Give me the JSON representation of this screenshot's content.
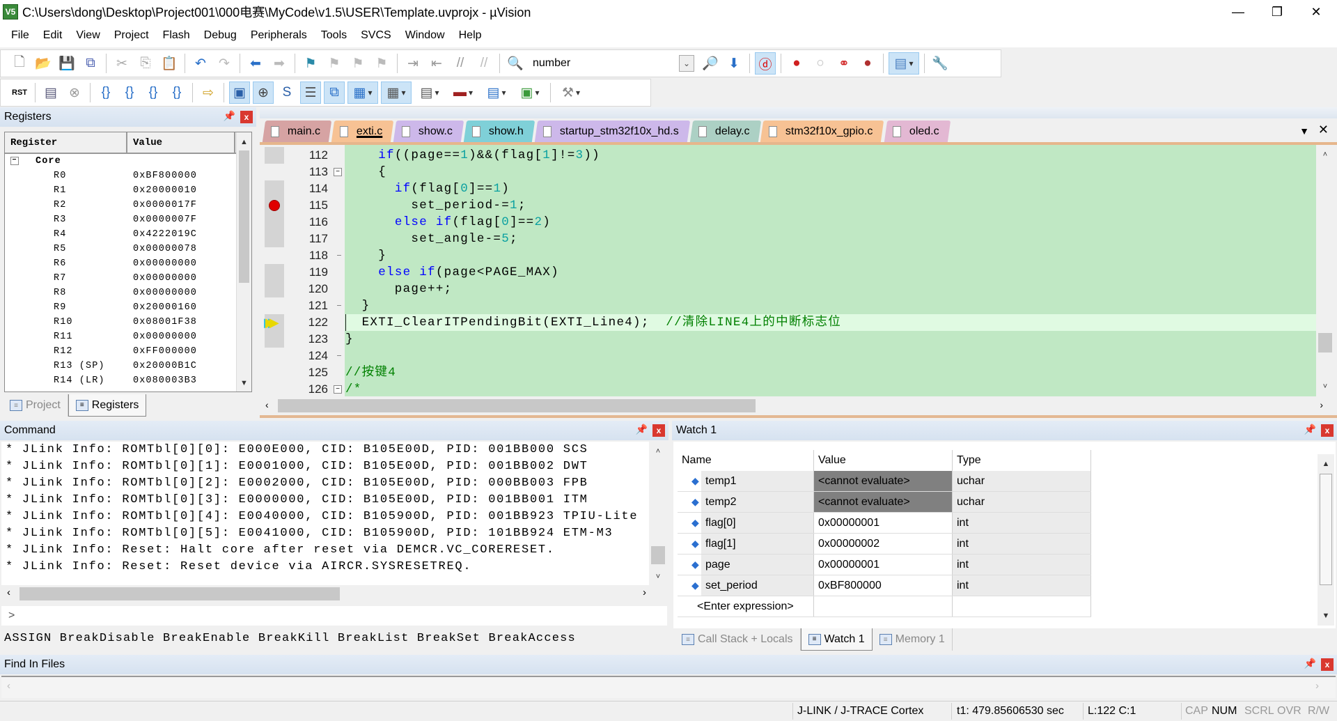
{
  "window": {
    "title": "C:\\Users\\dong\\Desktop\\Project001\\000电赛\\MyCode\\v1.5\\USER\\Template.uvprojx - µVision",
    "app_icon": "V5"
  },
  "menu": [
    "File",
    "Edit",
    "View",
    "Project",
    "Flash",
    "Debug",
    "Peripherals",
    "Tools",
    "SVCS",
    "Window",
    "Help"
  ],
  "toolbar1": {
    "find_value": "number",
    "icons": [
      {
        "n": "new-file-icon",
        "g": "🗋",
        "c": "#777"
      },
      {
        "n": "open-file-icon",
        "g": "📂",
        "c": "#d4a017"
      },
      {
        "n": "save-icon",
        "g": "💾",
        "c": "#2b4fa8"
      },
      {
        "n": "save-all-icon",
        "g": "⧉",
        "c": "#4a5fb0"
      },
      {
        "n": "sep"
      },
      {
        "n": "cut-icon",
        "g": "✂",
        "c": "#aaa"
      },
      {
        "n": "copy-icon",
        "g": "⎘",
        "c": "#aaa"
      },
      {
        "n": "paste-icon",
        "g": "📋",
        "c": "#c8a040"
      },
      {
        "n": "sep"
      },
      {
        "n": "undo-icon",
        "g": "↶",
        "c": "#2a70c8"
      },
      {
        "n": "redo-icon",
        "g": "↷",
        "c": "#bbb"
      },
      {
        "n": "sep"
      },
      {
        "n": "navigate-back-icon",
        "g": "⬅",
        "c": "#2a70c8"
      },
      {
        "n": "navigate-forward-icon",
        "g": "➡",
        "c": "#bbb"
      },
      {
        "n": "sep"
      },
      {
        "n": "bookmark-icon",
        "g": "⚑",
        "c": "#2a8aa8"
      },
      {
        "n": "prev-bookmark-icon",
        "g": "⚑",
        "c": "#bbb"
      },
      {
        "n": "next-bookmark-icon",
        "g": "⚑",
        "c": "#bbb"
      },
      {
        "n": "clear-bookmarks-icon",
        "g": "⚑",
        "c": "#bbb"
      },
      {
        "n": "sep"
      },
      {
        "n": "indent-icon",
        "g": "⇥",
        "c": "#999"
      },
      {
        "n": "unindent-icon",
        "g": "⇤",
        "c": "#999"
      },
      {
        "n": "comment-icon",
        "g": "//",
        "c": "#999"
      },
      {
        "n": "uncomment-icon",
        "g": "//",
        "c": "#bbb"
      },
      {
        "n": "sep"
      },
      {
        "n": "find-in-files-icon",
        "g": "🔍",
        "c": "#c8a040"
      }
    ],
    "icons_after": [
      {
        "n": "find-icon",
        "g": "🔎",
        "c": "#557"
      },
      {
        "n": "incremental-find-icon",
        "g": "⬇",
        "c": "#2a70c8"
      },
      {
        "n": "sep"
      },
      {
        "n": "debug-session-icon",
        "g": "ⓓ",
        "c": "#d00",
        "a": true
      },
      {
        "n": "sep"
      },
      {
        "n": "insert-breakpoint-icon",
        "g": "●",
        "c": "#d02020"
      },
      {
        "n": "enable-breakpoint-icon",
        "g": "○",
        "c": "#bbb"
      },
      {
        "n": "disable-all-breakpoints-icon",
        "g": "⚭",
        "c": "#d02020"
      },
      {
        "n": "kill-all-breakpoints-icon",
        "g": "●",
        "c": "#b03030"
      },
      {
        "n": "sep"
      },
      {
        "n": "window-layout-icon",
        "g": "▤",
        "c": "#4a7fc0",
        "a": true,
        "dd": true
      },
      {
        "n": "sep"
      },
      {
        "n": "configure-icon",
        "g": "🔧",
        "c": "#555"
      }
    ]
  },
  "toolbar2": {
    "icons": [
      {
        "n": "reset-icon",
        "g": "RST",
        "c": "#000"
      },
      {
        "n": "sep"
      },
      {
        "n": "run-icon",
        "g": "▤",
        "c": "#557"
      },
      {
        "n": "stop-icon",
        "g": "⊗",
        "c": "#999"
      },
      {
        "n": "sep"
      },
      {
        "n": "step-into-icon",
        "g": "{}",
        "c": "#2a70c8"
      },
      {
        "n": "step-over-icon",
        "g": "{}",
        "c": "#2a70c8"
      },
      {
        "n": "step-out-icon",
        "g": "{}",
        "c": "#2a70c8"
      },
      {
        "n": "run-to-cursor-icon",
        "g": "{}",
        "c": "#2a70c8"
      },
      {
        "n": "sep"
      },
      {
        "n": "show-next-statement-icon",
        "g": "⇨",
        "c": "#d0a020"
      },
      {
        "n": "sep"
      },
      {
        "n": "command-window-icon",
        "g": "▣",
        "c": "#2a5fa8",
        "a": true
      },
      {
        "n": "disassembly-window-icon",
        "g": "⊕",
        "c": "#444",
        "a": true
      },
      {
        "n": "symbols-window-icon",
        "g": "S",
        "c": "#2a5fa8"
      },
      {
        "n": "registers-window-icon",
        "g": "☰",
        "c": "#555",
        "a": true
      },
      {
        "n": "call-stack-window-icon",
        "g": "⧉",
        "c": "#2a70c8",
        "a": true
      },
      {
        "n": "watch-window-icon",
        "g": "▦",
        "c": "#2a70c8",
        "a": true,
        "dd": true
      },
      {
        "n": "memory-window-icon",
        "g": "▦",
        "c": "#555",
        "a": true,
        "dd": true
      },
      {
        "n": "serial-window-icon",
        "g": "▤",
        "c": "#555",
        "dd": true
      },
      {
        "n": "analysis-window-icon",
        "g": "▬",
        "c": "#a02020",
        "dd": true
      },
      {
        "n": "trace-window-icon",
        "g": "▤",
        "c": "#2a70c8",
        "dd": true
      },
      {
        "n": "system-viewer-icon",
        "g": "▣",
        "c": "#3a9a3a",
        "dd": true
      },
      {
        "n": "sep"
      },
      {
        "n": "toolbox-icon",
        "g": "⚒",
        "c": "#888",
        "dd": true
      }
    ]
  },
  "registers": {
    "title": "Registers",
    "col_register": "Register",
    "col_value": "Value",
    "group": "Core",
    "rows": [
      {
        "name": "R0",
        "value": "0xBF800000"
      },
      {
        "name": "R1",
        "value": "0x20000010"
      },
      {
        "name": "R2",
        "value": "0x0000017F"
      },
      {
        "name": "R3",
        "value": "0x0000007F"
      },
      {
        "name": "R4",
        "value": "0x4222019C"
      },
      {
        "name": "R5",
        "value": "0x00000078"
      },
      {
        "name": "R6",
        "value": "0x00000000"
      },
      {
        "name": "R7",
        "value": "0x00000000"
      },
      {
        "name": "R8",
        "value": "0x00000000"
      },
      {
        "name": "R9",
        "value": "0x20000160"
      },
      {
        "name": "R10",
        "value": "0x08001F38"
      },
      {
        "name": "R11",
        "value": "0x00000000"
      },
      {
        "name": "R12",
        "value": "0xFF000000"
      },
      {
        "name": "R13 (SP)",
        "value": "0x20000B1C"
      },
      {
        "name": "R14 (LR)",
        "value": "0x080003B3"
      }
    ],
    "tabs": [
      {
        "label": "Project",
        "active": false
      },
      {
        "label": "Registers",
        "active": true
      }
    ]
  },
  "editor": {
    "tabs": [
      {
        "label": "main.c",
        "color": "#d6a3a3",
        "active": false
      },
      {
        "label": "exti.c",
        "color": "#f7c294",
        "active": true
      },
      {
        "label": "show.c",
        "color": "#cdb8ea",
        "active": false
      },
      {
        "label": "show.h",
        "color": "#7fd0d8",
        "active": false
      },
      {
        "label": "startup_stm32f10x_hd.s",
        "color": "#cdb8ea",
        "active": false
      },
      {
        "label": "delay.c",
        "color": "#acd0c4",
        "active": false
      },
      {
        "label": "stm32f10x_gpio.c",
        "color": "#f7c294",
        "active": false
      },
      {
        "label": "oled.c",
        "color": "#e3b8d3",
        "active": false
      }
    ],
    "current_line": "122",
    "breakpoint_line": "115",
    "lines": [
      {
        "num": "112",
        "exec": true,
        "seg": [
          [
            "    ",
            ""
          ],
          [
            "if",
            "kw"
          ],
          [
            "((page==",
            ""
          ],
          [
            "1",
            "num"
          ],
          [
            ")&&(flag[",
            ""
          ],
          [
            "1",
            "num"
          ],
          [
            "]!=",
            ""
          ],
          [
            "3",
            "num"
          ],
          [
            "))",
            ""
          ]
        ]
      },
      {
        "num": "113",
        "fold": "open",
        "seg": [
          [
            "    {",
            ""
          ]
        ]
      },
      {
        "num": "114",
        "exec": true,
        "seg": [
          [
            "      ",
            ""
          ],
          [
            "if",
            "kw"
          ],
          [
            "(flag[",
            ""
          ],
          [
            "0",
            "num"
          ],
          [
            "]==",
            ""
          ],
          [
            "1",
            "num"
          ],
          [
            ")",
            ""
          ]
        ]
      },
      {
        "num": "115",
        "exec": true,
        "seg": [
          [
            "        set_period-=",
            ""
          ],
          [
            "1",
            "num"
          ],
          [
            ";",
            ""
          ]
        ]
      },
      {
        "num": "116",
        "exec": true,
        "seg": [
          [
            "      ",
            ""
          ],
          [
            "else if",
            "kw"
          ],
          [
            "(flag[",
            ""
          ],
          [
            "0",
            "num"
          ],
          [
            "]==",
            ""
          ],
          [
            "2",
            "num"
          ],
          [
            ")",
            ""
          ]
        ]
      },
      {
        "num": "117",
        "exec": true,
        "seg": [
          [
            "        set_angle-=",
            ""
          ],
          [
            "5",
            "num"
          ],
          [
            ";",
            ""
          ]
        ]
      },
      {
        "num": "118",
        "fold": "end",
        "seg": [
          [
            "    }",
            ""
          ]
        ]
      },
      {
        "num": "119",
        "exec": true,
        "seg": [
          [
            "    ",
            ""
          ],
          [
            "else if",
            "kw"
          ],
          [
            "(page<PAGE_MAX)",
            ""
          ]
        ]
      },
      {
        "num": "120",
        "exec": true,
        "seg": [
          [
            "      page++;",
            ""
          ]
        ]
      },
      {
        "num": "121",
        "fold": "end",
        "seg": [
          [
            "  }",
            ""
          ]
        ]
      },
      {
        "num": "122",
        "exec": true,
        "seg": [
          [
            "  EXTI_ClearITPendingBit(EXTI_Line4);  ",
            ""
          ],
          [
            "//清除LINE4上的中断标志位",
            "cmt"
          ]
        ]
      },
      {
        "num": "123",
        "exec": true,
        "seg": [
          [
            "}",
            ""
          ]
        ]
      },
      {
        "num": "124",
        "fold": "end",
        "seg": []
      },
      {
        "num": "125",
        "seg": [
          [
            "//按键4",
            "cmt"
          ]
        ]
      },
      {
        "num": "126",
        "fold": "open",
        "seg": [
          [
            "/*",
            "cmt"
          ]
        ]
      }
    ]
  },
  "command": {
    "title": "Command",
    "output": [
      "* JLink Info: ROMTbl[0][0]: E000E000, CID: B105E00D, PID: 001BB000 SCS",
      "* JLink Info: ROMTbl[0][1]: E0001000, CID: B105E00D, PID: 001BB002 DWT",
      "* JLink Info: ROMTbl[0][2]: E0002000, CID: B105E00D, PID: 000BB003 FPB",
      "* JLink Info: ROMTbl[0][3]: E0000000, CID: B105E00D, PID: 001BB001 ITM",
      "* JLink Info: ROMTbl[0][4]: E0040000, CID: B105900D, PID: 001BB923 TPIU-Lite",
      "* JLink Info: ROMTbl[0][5]: E0041000, CID: B105900D, PID: 101BB924 ETM-M3",
      "* JLink Info: Reset: Halt core after reset via DEMCR.VC_CORERESET.",
      "* JLink Info: Reset: Reset device via AIRCR.SYSRESETREQ."
    ],
    "prompt": ">",
    "hint": "ASSIGN BreakDisable BreakEnable BreakKill BreakList BreakSet BreakAccess"
  },
  "watch": {
    "title": "Watch 1",
    "col_name": "Name",
    "col_value": "Value",
    "col_type": "Type",
    "rows": [
      {
        "name": "temp1",
        "value": "<cannot evaluate>",
        "type": "uchar",
        "error": true
      },
      {
        "name": "temp2",
        "value": "<cannot evaluate>",
        "type": "uchar",
        "error": true
      },
      {
        "name": "flag[0]",
        "value": "0x00000001",
        "type": "int"
      },
      {
        "name": "flag[1]",
        "value": "0x00000002",
        "type": "int"
      },
      {
        "name": "page",
        "value": "0x00000001",
        "type": "int"
      },
      {
        "name": "set_period",
        "value": "0xBF800000",
        "type": "int"
      }
    ],
    "enter_expression": "<Enter expression>",
    "tabs": [
      {
        "label": "Call Stack + Locals",
        "active": false
      },
      {
        "label": "Watch 1",
        "active": true
      },
      {
        "label": "Memory 1",
        "active": false
      }
    ]
  },
  "find_in_files": {
    "title": "Find In Files"
  },
  "status": {
    "debugger": "J-LINK / J-TRACE Cortex",
    "time": "t1: 479.85606530 sec",
    "position": "L:122 C:1",
    "cap": "CAP",
    "num": "NUM",
    "scrl": "SCRL",
    "ovr": "OVR",
    "rw": "R/W"
  }
}
